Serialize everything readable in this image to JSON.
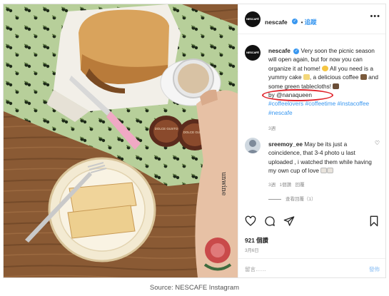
{
  "post": {
    "username": "nescafe",
    "follow_label": "追蹤",
    "avatar_text": "NESCAFÉ"
  },
  "caption": {
    "username": "nescafe",
    "line1": "Very soon the picnic season will open again, but for now you can organize it at home!",
    "line2": "All you need is a yummy cake",
    "line3": ", a delicious coffee",
    "line4": "and some green tablecloths!",
    "credit": "by @nanaqueen",
    "hashtags": "#coffeelovers #coffeetime #instacoffee #nescafe",
    "time": "3週"
  },
  "comment": {
    "username": "sreemoy_ee",
    "text": "May be its just a coincidence, that 3-4 photo u last uploaded , i watched them while having my own cup of love",
    "time": "3週",
    "likes": "1個讚",
    "reply": "回覆",
    "view_replies": "查看回覆（1）"
  },
  "likes": "921 個讚",
  "date": "3月6日",
  "comment_placeholder": "留言……",
  "post_button": "發佈",
  "source": "Source: NESCAFE Instagram",
  "photo": {
    "capsule_text_1": "DOLCE GUSTO",
    "capsule_text_2": "DOLCE GUSTO",
    "tattoo_text": "unwine"
  },
  "colors": {
    "link_blue": "#3897f0",
    "annotation_red": "#e0232b",
    "muted_gray": "#8e8e8e"
  },
  "icons": [
    "heart-icon",
    "comment-icon",
    "share-icon",
    "bookmark-icon",
    "more-options-icon",
    "verified-badge-icon"
  ]
}
